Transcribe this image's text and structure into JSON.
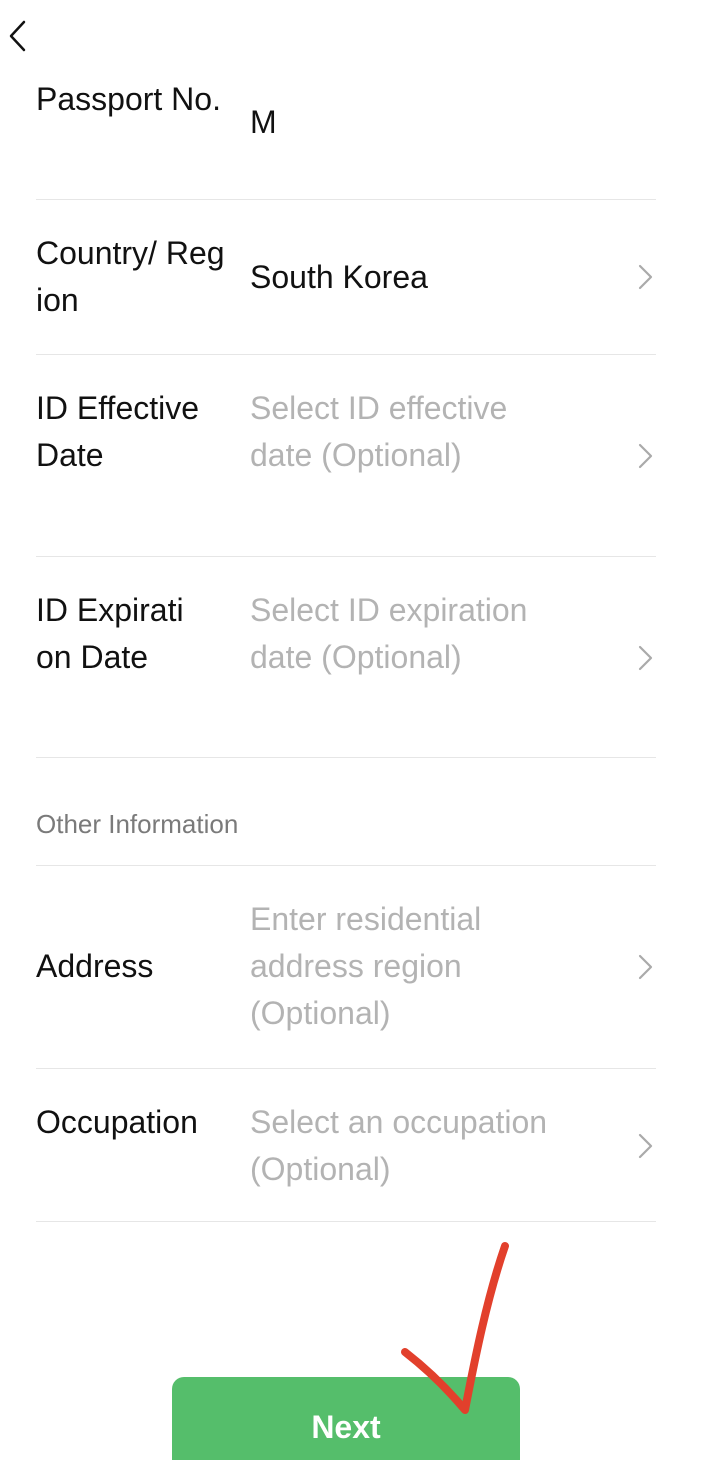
{
  "header": {
    "back_icon": "chevron-left-icon"
  },
  "fields": {
    "passport": {
      "label": "Passport No.",
      "value": "M"
    },
    "country": {
      "label": "Country/ Region",
      "value": "South Korea"
    },
    "effective_date": {
      "label": "ID Effective Date",
      "placeholder": "Select ID effective date (Optional)"
    },
    "expiration_date": {
      "label": "ID Expiration Date",
      "placeholder": "Select ID expiration date (Optional)"
    }
  },
  "other_section": {
    "title": "Other Information",
    "address": {
      "label": "Address",
      "placeholder": "Enter residential address region (Optional)"
    },
    "occupation": {
      "label": "Occupation",
      "placeholder": "Select an occupation (Optional)"
    }
  },
  "footer": {
    "next_label": "Next"
  },
  "colors": {
    "accent": "#55be6b",
    "placeholder": "#b3b3b3",
    "annotation": "#e2402c"
  },
  "annotation": {
    "icon": "red-checkmark-icon"
  }
}
